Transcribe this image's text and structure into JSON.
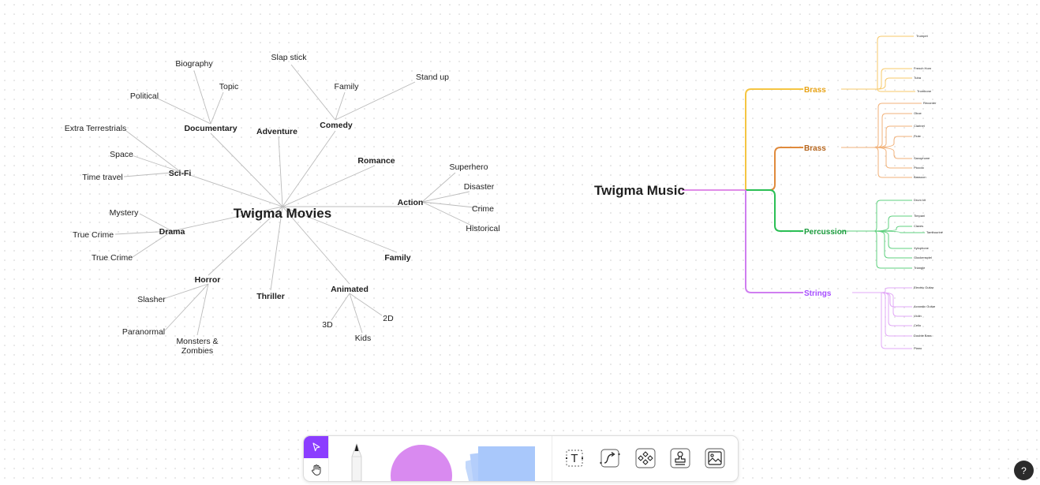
{
  "movies": {
    "root": "Twigma Movies",
    "branches": [
      {
        "label": "Documentary",
        "children": [
          "Biography",
          "Topic",
          "Political"
        ]
      },
      {
        "label": "Adventure",
        "children": []
      },
      {
        "label": "Comedy",
        "children": [
          "Slap stick",
          "Family",
          "Stand up"
        ]
      },
      {
        "label": "Romance",
        "children": []
      },
      {
        "label": "Action",
        "children": [
          "Superhero",
          "Disaster",
          "Crime",
          "Historical"
        ]
      },
      {
        "label": "Family",
        "children": []
      },
      {
        "label": "Animated",
        "children": [
          "2D",
          "3D",
          "Kids"
        ]
      },
      {
        "label": "Thriller",
        "children": []
      },
      {
        "label": "Horror",
        "children": [
          "Slasher",
          "Paranormal",
          "Monsters &",
          "Zombies"
        ]
      },
      {
        "label": "Drama",
        "children": [
          "Mystery",
          "True Crime",
          "True Crime"
        ]
      },
      {
        "label": "Sci-Fi",
        "children": [
          "Extra Terrestrials",
          "Space",
          "Time travel"
        ]
      }
    ]
  },
  "music": {
    "root": "Twigma Music",
    "branches": [
      {
        "label": "Brass",
        "color": "#e8a317",
        "children": [
          "Trumpet",
          "French Horn",
          "Tuba",
          "Trombone"
        ]
      },
      {
        "label": "Brass",
        "color": "#b5651d",
        "children": [
          "Recorder",
          "Oboe",
          "Clarinet",
          "Flute",
          "Saxophone",
          "Piccolo",
          "Bassoon"
        ]
      },
      {
        "label": "Percussion",
        "color": "#1a9b3c",
        "children": [
          "Drum kit",
          "Timpani",
          "Claves",
          "Tambourine",
          "Xylophone",
          "Glockenspiel",
          "Triangle"
        ]
      },
      {
        "label": "Strings",
        "color": "#a64dff",
        "children": [
          "Electric Guitar",
          "Acoustic Guitar",
          "Violin",
          "Cello",
          "Double Bass",
          "Piano"
        ]
      }
    ],
    "root_line_color": "#e08be8"
  },
  "toolbar": {
    "select_icon": "cursor-arrow-icon",
    "hand_icon": "hand-icon",
    "pen_icon": "marker-pen-icon",
    "shape_icon": "circle-shape-icon",
    "sticky_icon": "sticky-note-icon",
    "text_tool": "T",
    "connector_icon": "connector-icon",
    "component_icon": "component-icon",
    "stamp_icon": "stamp-icon",
    "image_icon": "image-icon",
    "accent": "#8b3dff",
    "shape_color": "#d98af0",
    "sticky_color": "#a9c8fb"
  },
  "help": {
    "label": "?"
  }
}
